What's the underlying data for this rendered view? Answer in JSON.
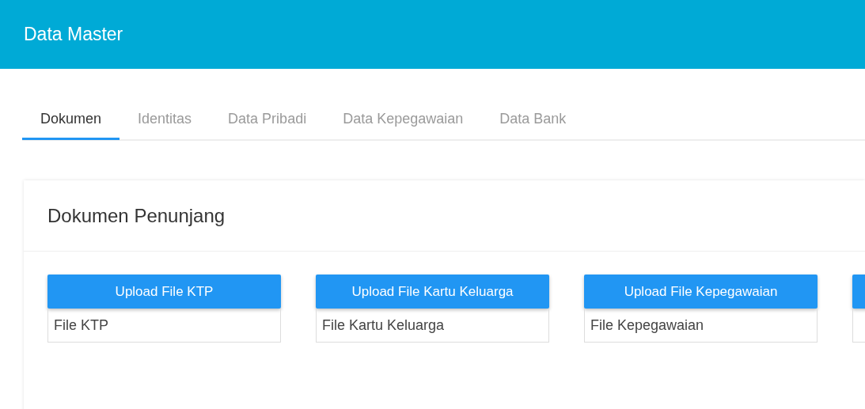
{
  "header": {
    "title": "Data Master"
  },
  "tabs": [
    {
      "label": "Dokumen",
      "selected": true
    },
    {
      "label": "Identitas",
      "selected": false
    },
    {
      "label": "Data Pribadi",
      "selected": false
    },
    {
      "label": "Data Kepegawaian",
      "selected": false
    },
    {
      "label": "Data Bank",
      "selected": false
    }
  ],
  "card": {
    "title": "Dokumen Penunjang",
    "uploads": [
      {
        "button": "Upload File KTP",
        "field": "File KTP"
      },
      {
        "button": "Upload File Kartu Keluarga",
        "field": "File Kartu Keluarga"
      },
      {
        "button": "Upload File Kepegawaian",
        "field": "File Kepegawaian"
      }
    ]
  }
}
